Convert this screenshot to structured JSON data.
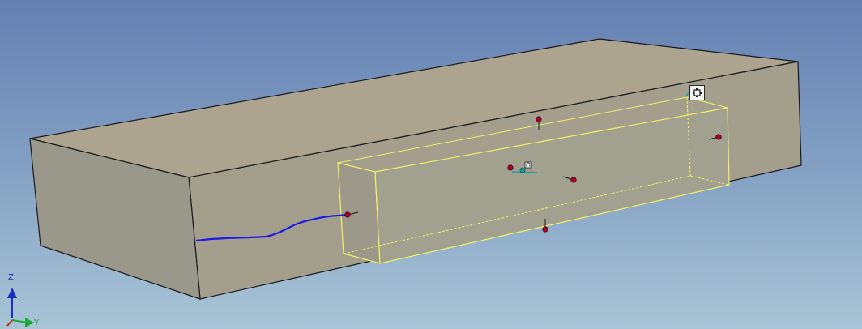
{
  "viewport": {
    "background_top": "#6480b2",
    "background_bottom": "#a8c5d6"
  },
  "model": {
    "body_color": "#aca48e",
    "body_side_color": "#a29c89",
    "body_front_color": "#99968a",
    "edge_color": "#1a1a1a",
    "selection_color": "#f2f06a",
    "curve_color": "#1a1ae6",
    "handle_color": "#b0002a"
  },
  "triad": {
    "z_label": "Z",
    "y_label": "Y",
    "z_color": "#1b2fbf",
    "y_color": "#1fa83a"
  },
  "toolbar": {
    "transform_icon": "move-transform-icon"
  }
}
